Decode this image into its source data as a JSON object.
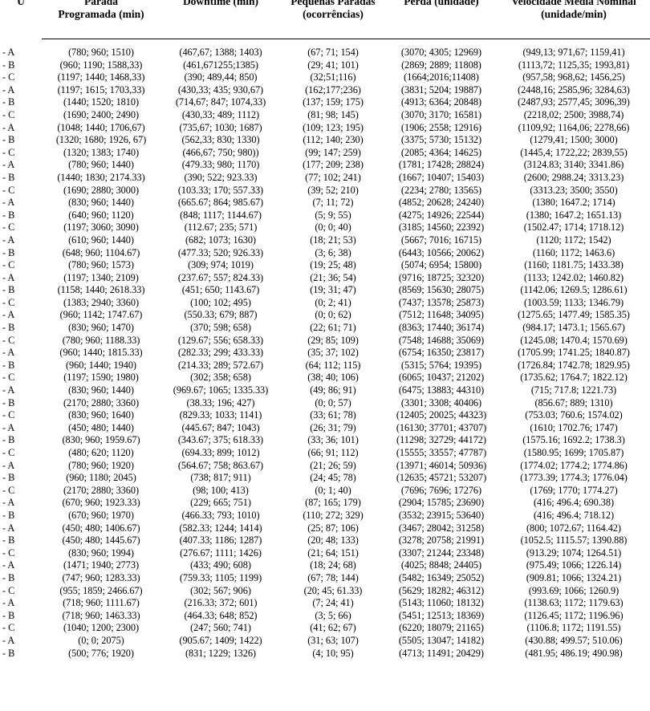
{
  "table": {
    "columns": [
      {
        "key": "u",
        "label": "U"
      },
      {
        "key": "pp",
        "label": "Parada Programada (min)"
      },
      {
        "key": "dt",
        "label": "Downtime (min)"
      },
      {
        "key": "pq",
        "label": "Pequenas Paradas (ocorrências)"
      },
      {
        "key": "pe",
        "label": "Perda (unidade)"
      },
      {
        "key": "vm",
        "label": "Velocidade Média Nominal (unidade/min)"
      }
    ],
    "column_labels_wrapped": [
      [
        "U"
      ],
      [
        "Parada",
        "Programada (min)"
      ],
      [
        "Downtime (min)"
      ],
      [
        "Pequenas Paradas",
        "(ocorrências)"
      ],
      [
        "Perda (unidade)"
      ],
      [
        "Velocidade Média Nominal",
        "(unidade/min)"
      ]
    ],
    "rows": [
      {
        "u": "- A",
        "pp": "(780; 960; 1510)",
        "dt": "(467,67; 1388; 1403)",
        "pq": "(67; 71; 154)",
        "pe": "(3070; 4305; 12969)",
        "vm": "(949,13; 971,67; 1159,41)"
      },
      {
        "u": "- B",
        "pp": "(960; 1190; 1588,33)",
        "dt": "(461,671255;1385)",
        "pq": "(29; 41; 101)",
        "pe": "(2869; 2889; 11808)",
        "vm": "(1113,72; 1125,35; 1993,81)"
      },
      {
        "u": "- C",
        "pp": "(1197; 1440; 1468,33)",
        "dt": "(390; 489,44; 850)",
        "pq": "(32;51;116)",
        "pe": "(1664;2016;11408)",
        "vm": "(957,58; 968,62; 1456,25)"
      },
      {
        "u": "- A",
        "pp": "(1197; 1615; 1703,33)",
        "dt": "(430,33; 435; 930,67)",
        "pq": "(162;177;236)",
        "pe": "(3831; 5204; 19887)",
        "vm": "(2448,16; 2585,96; 3284,63)"
      },
      {
        "u": "- B",
        "pp": "(1440; 1520; 1810)",
        "dt": "(714,67; 847; 1074,33)",
        "pq": "(137; 159; 175)",
        "pe": "(4913; 6364; 20848)",
        "vm": "(2487,93; 2577,45; 3096,39)"
      },
      {
        "u": "- C",
        "pp": "(1690; 2400; 2490)",
        "dt": "(430,33; 489; 1112)",
        "pq": "(81; 98; 145)",
        "pe": "(3070; 3170; 16581)",
        "vm": "(2218,02; 2500; 3988,74)"
      },
      {
        "u": "- A",
        "pp": "(1048; 1440; 1706,67)",
        "dt": "(735,67; 1030; 1687)",
        "pq": "(109; 123; 195)",
        "pe": "(1906; 2558; 12916)",
        "vm": "(1109,92; 1164,06; 2278,66)"
      },
      {
        "u": "- B",
        "pp": "(1320; 1680; 1926, 67)",
        "dt": "(562,33; 830; 1330)",
        "pq": "(112; 140; 230)",
        "pe": "(3375; 5730; 15132)",
        "vm": "(1279,41; 1500; 3000)"
      },
      {
        "u": "- C",
        "pp": "(1320; 1383; 1740)",
        "dt": "(466,67; 750; 980))",
        "pq": "(99; 147; 259)",
        "pe": "(2085; 4364; 14625)",
        "vm": "(1445,4; 1722,22; 2839,55)"
      },
      {
        "u": "- A",
        "pp": "(780; 960; 1440)",
        "dt": "(479.33; 980; 1170)",
        "pq": "(177; 209; 238)",
        "pe": "(1781; 17428; 28824)",
        "vm": "(3124.83; 3140; 3341.86)"
      },
      {
        "u": "- B",
        "pp": "(1440; 1830; 2174.33)",
        "dt": "(390; 522; 923.33)",
        "pq": "(77; 102; 241)",
        "pe": "(1667; 10407; 15403)",
        "vm": "(2600; 2988.24; 3313.23)"
      },
      {
        "u": "- C",
        "pp": "(1690; 2880; 3000)",
        "dt": "(103.33; 170; 557.33)",
        "pq": "(39; 52; 210)",
        "pe": "(2234; 2780; 13565)",
        "vm": "(3313.23; 3500; 3550)"
      },
      {
        "u": "- A",
        "pp": "(830; 960; 1440)",
        "dt": "(665.67; 864; 985.67)",
        "pq": "(7; 11; 72)",
        "pe": "(4852; 20628; 24240)",
        "vm": "(1380; 1647.2; 1714)"
      },
      {
        "u": "- B",
        "pp": "(640; 960; 1120)",
        "dt": "(848; 1117; 1144.67)",
        "pq": "(5; 9; 55)",
        "pe": "(4275; 14926; 22544)",
        "vm": "(1380; 1647.2; 1651.13)"
      },
      {
        "u": "- C",
        "pp": "(1197; 3060; 3090)",
        "dt": "(112.67; 235; 571)",
        "pq": "(0; 0; 40)",
        "pe": "(3185; 14560; 22392)",
        "vm": "(1502.47; 1714; 1718.12)"
      },
      {
        "u": "- A",
        "pp": "(610; 960; 1440)",
        "dt": "(682; 1073; 1630)",
        "pq": "(18; 21; 53)",
        "pe": "(5667; 7016; 16715)",
        "vm": "(1120; 1172; 1542)"
      },
      {
        "u": "- B",
        "pp": "(648; 960; 1104.67)",
        "dt": "(477.33; 520; 926.33)",
        "pq": "(3; 6; 38)",
        "pe": "(6443; 10566; 20062)",
        "vm": "(1160; 1172; 1463.6)"
      },
      {
        "u": "- C",
        "pp": "(780; 960; 1573)",
        "dt": "(309; 974; 1019)",
        "pq": "(19; 25; 48)",
        "pe": "(5074; 6954; 15800)",
        "vm": "(1160; 1181.75; 1433.38)"
      },
      {
        "u": "- A",
        "pp": "(1197; 1340; 2109)",
        "dt": "(237.67; 557; 824.33)",
        "pq": "(21; 36; 54)",
        "pe": "(9716; 18725; 32320)",
        "vm": "(1133; 1242.02; 1460.82)"
      },
      {
        "u": "- B",
        "pp": "(1158; 1440; 2618.33)",
        "dt": "(451; 650; 1143.67)",
        "pq": "(19; 31; 47)",
        "pe": "(8569; 15630; 28075)",
        "vm": "(1142.06; 1269.5; 1286.61)"
      },
      {
        "u": "- C",
        "pp": "(1383; 2940; 3360)",
        "dt": "(100; 102; 495)",
        "pq": "(0; 2; 41)",
        "pe": "(7437; 13578; 25873)",
        "vm": "(1003.59; 1133; 1346.79)"
      },
      {
        "u": "- A",
        "pp": "(960; 1142; 1747.67)",
        "dt": "(550.33; 679; 887)",
        "pq": "(0; 0; 62)",
        "pe": "(7512; 11648; 34095)",
        "vm": "(1275.65; 1477.49; 1585.35)"
      },
      {
        "u": "- B",
        "pp": "(830; 960; 1470)",
        "dt": "(370; 598; 658)",
        "pq": "(22; 61; 71)",
        "pe": "(8363; 17440; 36174)",
        "vm": "(984.17; 1473.1; 1565.67)"
      },
      {
        "u": "- C",
        "pp": "(780; 960; 1188.33)",
        "dt": "(129.67; 556; 658.33)",
        "pq": "(29; 85; 109)",
        "pe": "(7548; 14688; 35069)",
        "vm": "(1245.08; 1470.4; 1570.69)"
      },
      {
        "u": "- A",
        "pp": "(960; 1440; 1815.33)",
        "dt": "(282.33; 299; 433.33)",
        "pq": "(35; 37; 102)",
        "pe": "(6754; 16350; 23817)",
        "vm": "(1705.99; 1741.25; 1840.87)"
      },
      {
        "u": "- B",
        "pp": "(960; 1440; 1940)",
        "dt": "(214.33; 289; 572.67)",
        "pq": "(64; 112; 115)",
        "pe": "(5315; 5764; 19395)",
        "vm": "(1726.84; 1742.78; 1829.95)"
      },
      {
        "u": "- C",
        "pp": "(1197; 1590; 1980)",
        "dt": "(302; 358; 658)",
        "pq": "(38; 40; 106)",
        "pe": "(6065; 10437; 21202)",
        "vm": "(1735.62; 1764.7; 1822.12)"
      },
      {
        "u": "- A",
        "pp": "(830; 960; 1440)",
        "dt": "(969.67; 1065; 1335.33)",
        "pq": "(49; 86; 91)",
        "pe": "(6475; 13883; 44310)",
        "vm": "(715; 717.8; 1221.73)"
      },
      {
        "u": "- B",
        "pp": "(2170; 2880; 3360)",
        "dt": "(38.33; 196; 427)",
        "pq": "(0; 0; 57)",
        "pe": "(3301; 3308; 40406)",
        "vm": "(856.67; 889; 1310)"
      },
      {
        "u": "- C",
        "pp": "(830; 960; 1640)",
        "dt": "(829.33; 1033; 1141)",
        "pq": "(33; 61; 78)",
        "pe": "(12405; 20025; 44323)",
        "vm": "(753.03; 760.6; 1574.02)"
      },
      {
        "u": "- A",
        "pp": "(450; 480; 1440)",
        "dt": "(445.67; 847; 1043)",
        "pq": "(26; 31; 79)",
        "pe": "(16130; 37701; 43707)",
        "vm": "(1610; 1702.76; 1747)"
      },
      {
        "u": "- B",
        "pp": "(830; 960; 1959.67)",
        "dt": "(343.67; 375; 618.33)",
        "pq": "(33; 36; 101)",
        "pe": "(11298; 32729; 44172)",
        "vm": "(1575.16; 1692.2; 1738.3)"
      },
      {
        "u": "- C",
        "pp": "(480; 620; 1120)",
        "dt": "(694.33; 899; 1012)",
        "pq": "(66; 91; 112)",
        "pe": "(15555; 33557; 47787)",
        "vm": "(1580.95; 1699; 1705.87)"
      },
      {
        "u": "- A",
        "pp": "(780; 960; 1920)",
        "dt": "(564.67; 758; 863.67)",
        "pq": "(21; 26; 59)",
        "pe": "(13971; 46014; 50936)",
        "vm": "(1774.02; 1774.2; 1774.86)"
      },
      {
        "u": "- B",
        "pp": "(960; 1180; 2045)",
        "dt": "(738; 817; 911)",
        "pq": "(24; 45; 78)",
        "pe": "(12635; 45721; 53207)",
        "vm": "(1773.39; 1774.3; 1776.04)"
      },
      {
        "u": "- C",
        "pp": "(2170; 2880; 3360)",
        "dt": "(98; 100; 413)",
        "pq": "(0; 1; 40)",
        "pe": "(7696; 7696; 17276)",
        "vm": "(1769; 1770; 1774.27)"
      },
      {
        "u": "- A",
        "pp": "(670; 960; 1923.33)",
        "dt": "(229; 665; 751)",
        "pq": "(87; 165; 179)",
        "pe": "(2904; 15785; 23690)",
        "vm": "(416; 496.4; 690.38)"
      },
      {
        "u": "- B",
        "pp": "(670; 960; 1970)",
        "dt": "(466.33; 793; 1010)",
        "pq": "(110; 272; 329)",
        "pe": "(3532; 23915; 53640)",
        "vm": "(416; 496.4; 718.12)"
      },
      {
        "u": "- A",
        "pp": "(450; 480; 1406.67)",
        "dt": "(582.33; 1244; 1414)",
        "pq": "(25; 87; 106)",
        "pe": "(3467; 28042; 31258)",
        "vm": "(800; 1072.67; 1164.42)"
      },
      {
        "u": "- B",
        "pp": "(450; 480; 1445.67)",
        "dt": "(407.33; 1186; 1287)",
        "pq": "(20; 48; 133)",
        "pe": "(3278; 20758; 21991)",
        "vm": "(1052.5; 1115.57; 1390.88)"
      },
      {
        "u": "- C",
        "pp": "(830; 960; 1994)",
        "dt": "(276.67; 1111; 1426)",
        "pq": "(21; 64; 151)",
        "pe": "(3307; 21244; 23348)",
        "vm": "(913.29; 1074; 1264.51)"
      },
      {
        "u": "- A",
        "pp": "(1471; 1940; 2773)",
        "dt": "(433; 490; 608)",
        "pq": "(18; 24; 68)",
        "pe": "(4025; 8848; 24405)",
        "vm": "(975.49; 1066; 1226.14)"
      },
      {
        "u": "- B",
        "pp": "(747; 960; 1283.33)",
        "dt": "(759.33; 1105; 1199)",
        "pq": "(67; 78; 144)",
        "pe": "(5482; 16349; 25052)",
        "vm": "(909.81; 1066; 1324.21)"
      },
      {
        "u": "- C",
        "pp": "(955; 1859; 2466.67)",
        "dt": "(302; 567; 906)",
        "pq": "(20; 45; 61.33)",
        "pe": "(5629; 18282; 46312)",
        "vm": "(993.69; 1066; 1260.9)"
      },
      {
        "u": "- A",
        "pp": "(718; 960; 1111.67)",
        "dt": "(216.33; 372; 601)",
        "pq": "(7; 24; 41)",
        "pe": "(5143; 11060; 18132)",
        "vm": "(1138.63; 1172; 1179.63)"
      },
      {
        "u": "- B",
        "pp": "(718; 960; 1463.33)",
        "dt": "(464.33; 648; 852)",
        "pq": "(3; 5; 66)",
        "pe": "(5451; 12513; 18369)",
        "vm": "(1126.45; 1172; 1196.96)"
      },
      {
        "u": "- C",
        "pp": "(1040; 1200; 2300)",
        "dt": "(247; 560; 741)",
        "pq": "(41; 62; 67)",
        "pe": "(6220; 18079; 21165)",
        "vm": "(1106.8; 1172; 1191.55)"
      },
      {
        "u": "- A",
        "pp": "(0; 0; 2075)",
        "dt": "(905.67; 1409; 1422)",
        "pq": "(31; 63; 107)",
        "pe": "(5505; 13047; 14182)",
        "vm": "(430.88; 499.57; 510.06)"
      },
      {
        "u": "- B",
        "pp": "(500; 776; 1920)",
        "dt": "(831; 1229; 1326)",
        "pq": "(4; 10; 95)",
        "pe": "(4713; 11491; 20429)",
        "vm": "(481.95; 486.19; 490.98)"
      }
    ]
  }
}
